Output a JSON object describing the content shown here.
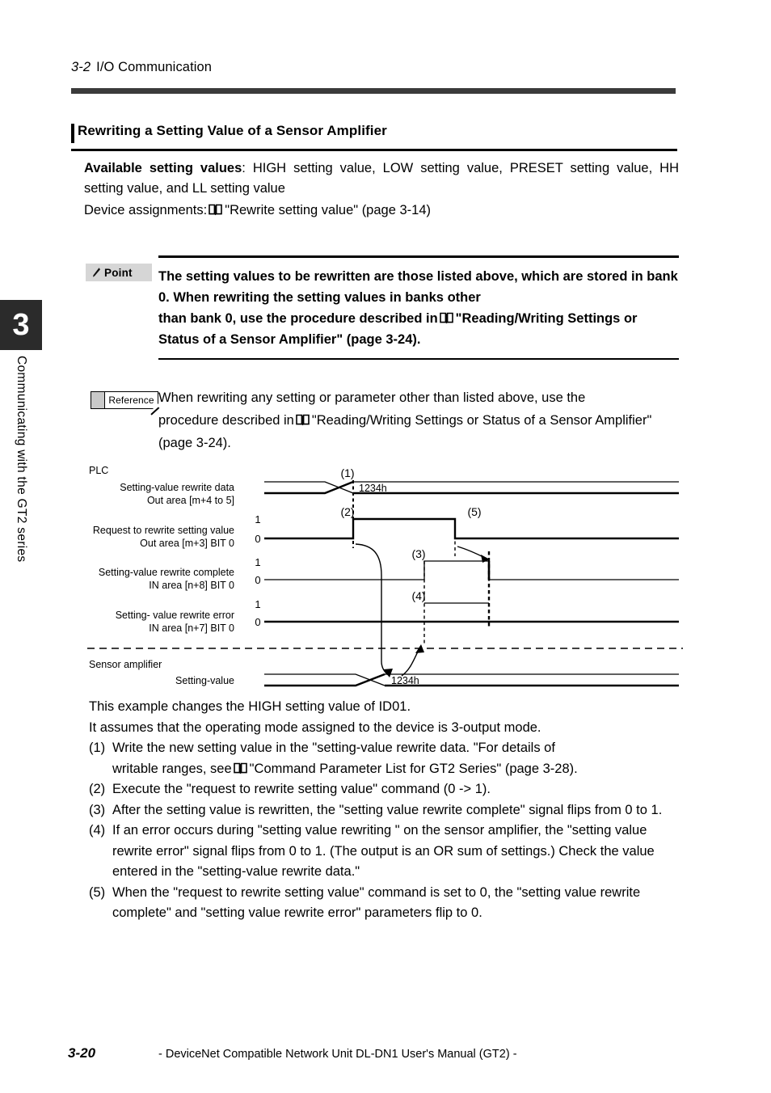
{
  "running_head": {
    "number": "3-2",
    "title": "I/O Communication"
  },
  "chapter_tab": {
    "number": "3",
    "vertical_title": "Communicating with the GT2 series"
  },
  "section": {
    "heading": "Rewriting a Setting Value of a Sensor Amplifier"
  },
  "intro": {
    "available_label": "Available setting values",
    "available_rest": ": HIGH setting value, LOW setting value, PRESET setting value, HH setting value, and LL setting value",
    "device_prefix": "Device assignments:",
    "device_ref": "\"Rewrite setting value\" (page 3-14)"
  },
  "point": {
    "badge_label": "Point",
    "badge_icon": "pen-icon",
    "line1": "The setting values to be rewritten are those listed above, which are stored in bank 0. When rewriting the setting values in banks other",
    "line2_prefix": "than bank 0, use the procedure described in",
    "line2_ref": "\"Reading/Writing Settings or Status of a Sensor Amplifier\" (page 3-24)."
  },
  "reference": {
    "badge_label": "Reference",
    "line1": "When rewriting any setting or parameter other than listed above, use the",
    "line2_prefix": "procedure described in",
    "line2_ref": "\"Reading/Writing Settings or Status of a Sensor Amplifier\" (page 3-24)."
  },
  "diagram": {
    "group_plc": "PLC",
    "group_sensor": "Sensor amplifier",
    "signals": [
      {
        "name": "Setting-value rewrite data",
        "address": "Out area [m+4 to 5]",
        "type": "bus",
        "value_label": "1234h",
        "marker": "(1)"
      },
      {
        "name": "Request to rewrite setting value",
        "address": "Out area [m+3] BIT 0",
        "type": "digital",
        "high_label": "1",
        "low_label": "0",
        "rise_marker": "(2)",
        "fall_marker": "(5)"
      },
      {
        "name": "Setting-value rewrite complete",
        "address": "IN area [n+8] BIT 0",
        "type": "digital",
        "high_label": "1",
        "low_label": "0",
        "rise_marker": "(3)"
      },
      {
        "name": "Setting- value rewrite error",
        "address": "IN area [n+7] BIT 0",
        "type": "digital",
        "high_label": "1",
        "low_label": "0",
        "rise_marker": "(4)"
      },
      {
        "name": "Setting-value",
        "address": "",
        "type": "bus",
        "value_label": "1234h"
      }
    ]
  },
  "explanation": {
    "intro1": "This example changes the HIGH setting value of ID01.",
    "intro2": "It assumes that the operating mode assigned to the device is 3-output mode.",
    "items": [
      {
        "marker": "(1)",
        "text_a": "Write the new setting value in the \"setting-value rewrite data. \"For details of",
        "text_b_prefix": "writable ranges, see",
        "text_b_ref": "\"Command Parameter List for GT2 Series\" (page 3-28)."
      },
      {
        "marker": "(2)",
        "text": "Execute the \"request to rewrite setting value\" command (0 -> 1)."
      },
      {
        "marker": "(3)",
        "text": "After the setting value is rewritten, the \"setting value rewrite complete\" signal flips from 0 to 1."
      },
      {
        "marker": "(4)",
        "text": "If an error occurs during \"setting value rewriting \" on the sensor amplifier, the \"setting value rewrite error\" signal flips from 0 to 1. (The output is an OR sum of settings.) Check the value entered in the \"setting-value rewrite data.\""
      },
      {
        "marker": "(5)",
        "text": "When the \"request to rewrite setting value\" command is set to 0, the \"setting value rewrite complete\" and \"setting value rewrite error\" parameters flip to 0."
      }
    ]
  },
  "footer": {
    "page_number": "3-20",
    "manual_title": "- DeviceNet Compatible Network Unit DL-DN1 User's Manual (GT2) -"
  }
}
